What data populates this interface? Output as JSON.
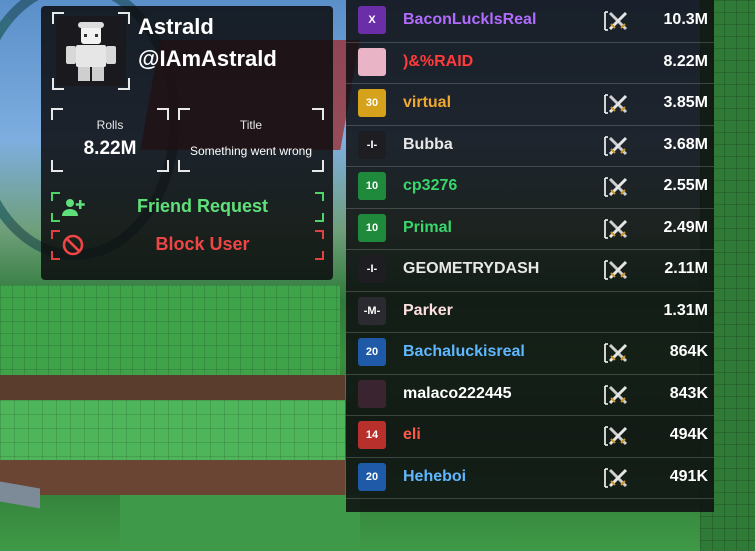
{
  "profile": {
    "display_name": "Astrald",
    "handle": "@IAmAstrald",
    "stats": {
      "rolls_label": "Rolls",
      "rolls_value": "8.22M",
      "title_label": "Title",
      "title_value": "Something went wrong"
    },
    "friend_request_label": "Friend Request",
    "block_user_label": "Block User",
    "colors": {
      "friend": "#5fe07a",
      "block": "#f04545"
    }
  },
  "leaderboard": [
    {
      "name": "BaconLucklsReal",
      "count": "10.3M",
      "badge": "X",
      "badge_color": "#6a2ea8",
      "name_color": "#b26bff",
      "swords": true
    },
    {
      "name": ")&%RAID",
      "count": "8.22M",
      "badge": "",
      "badge_color": "#e8b4c6",
      "name_color": "#ff3b3b",
      "swords": false
    },
    {
      "name": "virtual",
      "count": "3.85M",
      "badge": "30",
      "badge_color": "#d6a21c",
      "name_color": "#f0a830",
      "swords": true
    },
    {
      "name": "Bubba",
      "count": "3.68M",
      "badge": "-I-",
      "badge_color": "#1e1e22",
      "name_color": "#e8e8e8",
      "swords": true
    },
    {
      "name": "cp3276",
      "count": "2.55M",
      "badge": "10",
      "badge_color": "#1f8a3c",
      "name_color": "#39d66b",
      "swords": true
    },
    {
      "name": "Primal",
      "count": "2.49M",
      "badge": "10",
      "badge_color": "#1f8a3c",
      "name_color": "#39d66b",
      "swords": true
    },
    {
      "name": "GEOMETRYDASH",
      "count": "2.11M",
      "badge": "-I-",
      "badge_color": "#1e1e22",
      "name_color": "#e8e8e8",
      "swords": true
    },
    {
      "name": "Parker",
      "count": "1.31M",
      "badge": "-M-",
      "badge_color": "#2a2a30",
      "name_color": "#ffe0e0",
      "swords": false
    },
    {
      "name": "Bachaluckisreal",
      "count": "864K",
      "badge": "20",
      "badge_color": "#1e5aa8",
      "name_color": "#5fb7ff",
      "swords": true
    },
    {
      "name": "malaco222445",
      "count": "843K",
      "badge": "",
      "badge_color": "#3a2430",
      "name_color": "#ffffff",
      "swords": true
    },
    {
      "name": "eli",
      "count": "494K",
      "badge": "14",
      "badge_color": "#b8302c",
      "name_color": "#ff5a4a",
      "swords": true
    },
    {
      "name": "Heheboi",
      "count": "491K",
      "badge": "20",
      "badge_color": "#1e5aa8",
      "name_color": "#5fb7ff",
      "swords": true
    }
  ],
  "icons": {
    "friend": "person-add-icon",
    "block": "block-icon",
    "swords": "crossed-swords-icon"
  }
}
